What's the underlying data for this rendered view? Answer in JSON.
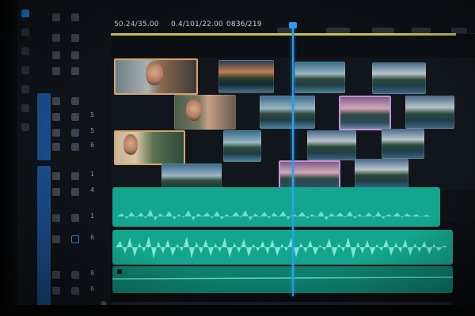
{
  "ruler": {
    "timecodes": [
      "50.24/35.00",
      "0.4/101/22.00",
      "0836/219"
    ],
    "blurred_markers": 6
  },
  "track_headers": {
    "rows": [
      {
        "num": "",
        "icon": "phone-icon"
      },
      {
        "num": "",
        "icon": "grid-icon"
      },
      {
        "num": "",
        "icon": "lock-icon"
      },
      {
        "num": "",
        "icon": "person-icon"
      },
      {
        "num": "",
        "icon": "lock-icon"
      },
      {
        "num": "5",
        "icon": "lock-icon"
      },
      {
        "num": "5",
        "icon": "lock-icon"
      },
      {
        "num": "6",
        "icon": "lock-icon"
      },
      {
        "num": "1",
        "icon": "lock-icon"
      },
      {
        "num": "4",
        "icon": "lock-icon"
      },
      {
        "num": "1",
        "icon": "lock-icon"
      },
      {
        "num": "6",
        "icon": "lock-icon"
      },
      {
        "num": "8",
        "icon": "lock-icon"
      },
      {
        "num": "6",
        "icon": "lock-icon"
      }
    ]
  },
  "colors": {
    "accent": "#2c9ef0",
    "work_area": "#c9c24a",
    "audio": "#13a58d",
    "audio_dark": "#0e7f6e",
    "track_strip": "#1a4f8e"
  }
}
